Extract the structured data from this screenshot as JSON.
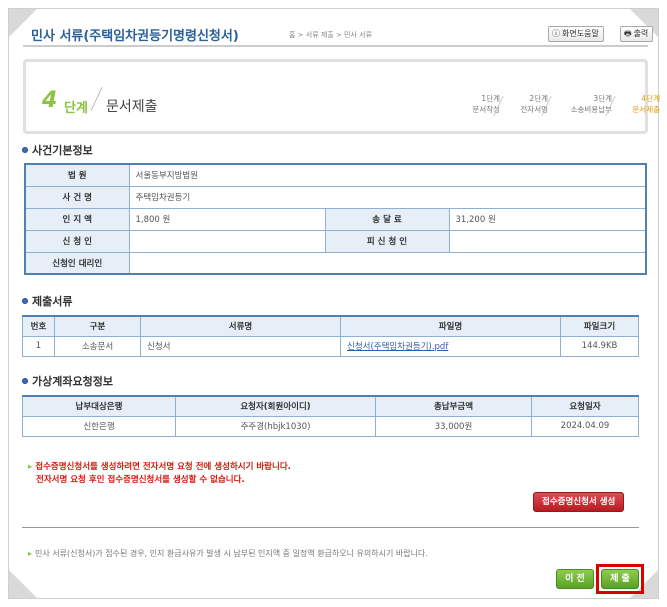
{
  "header": {
    "title": "민사 서류(주택임차권등기명령신청서)",
    "breadcrumb": "홈 > 서류 제출 > 민사 서류",
    "help_label": "화면도움말",
    "print_label": "출력"
  },
  "step": {
    "number": "4",
    "word": "단계",
    "label": "문서제출",
    "items": [
      {
        "num": "1단계",
        "name": "문서작성"
      },
      {
        "num": "2단계",
        "name": "전자서명"
      },
      {
        "num": "3단계",
        "name": "소송비용납부"
      },
      {
        "num": "4단계",
        "name": "문서제출"
      }
    ]
  },
  "case_info": {
    "section_title": "사건기본정보",
    "court_label": "법 원",
    "court_value": "서울동부지방법원",
    "case_name_label": "사 건 명",
    "case_name_value": "주택임차권등기",
    "stamp_label": "인 지 액",
    "stamp_value": "1,800 원",
    "service_label": "송 달 료",
    "service_value": "31,200 원",
    "applicant_label": "신 청 인",
    "applicant_value": "",
    "respondent_label": "피 신 청 인",
    "respondent_value": "",
    "agent_label": "신청인 대리인",
    "agent_value": ""
  },
  "documents": {
    "section_title": "제출서류",
    "headers": [
      "번호",
      "구분",
      "서류명",
      "파일명",
      "파일크기"
    ],
    "rows": [
      {
        "no": "1",
        "type": "소송문서",
        "name": "신청서",
        "file": "신청서(주택임차권등기).pdf",
        "size": "144.9KB"
      }
    ]
  },
  "bank": {
    "section_title": "가상계좌요청정보",
    "headers": [
      "납부대상은행",
      "요청자(회원아이디)",
      "총납부금액",
      "요청일자"
    ],
    "rows": [
      {
        "bank": "신한은행",
        "requester": "주주경(hbjk1030)",
        "amount": "33,000원",
        "date": "2024.04.09"
      }
    ]
  },
  "notice": {
    "line1": "접수증명신청서를 생성하려면 전자서명 요청 전에 생성하시기 바랍니다.",
    "line2": "전자서명 요청 후인 접수증명신청서를 생성할 수 없습니다."
  },
  "generate_button": "접수증명신청서 생성",
  "footnote": "민사 서류(신청서)가 접수된 경우, 인지 환급사유가 발생 시 납부된 인지액 중 일정액 환급하오니 유의하시기 바랍니다.",
  "buttons": {
    "prev": "이 전",
    "submit": "제 출"
  },
  "colors": {
    "accent_green": "#8bc43f",
    "title_blue": "#2a6199",
    "notice_red": "#d8190f",
    "highlight_red": "#d90000"
  }
}
